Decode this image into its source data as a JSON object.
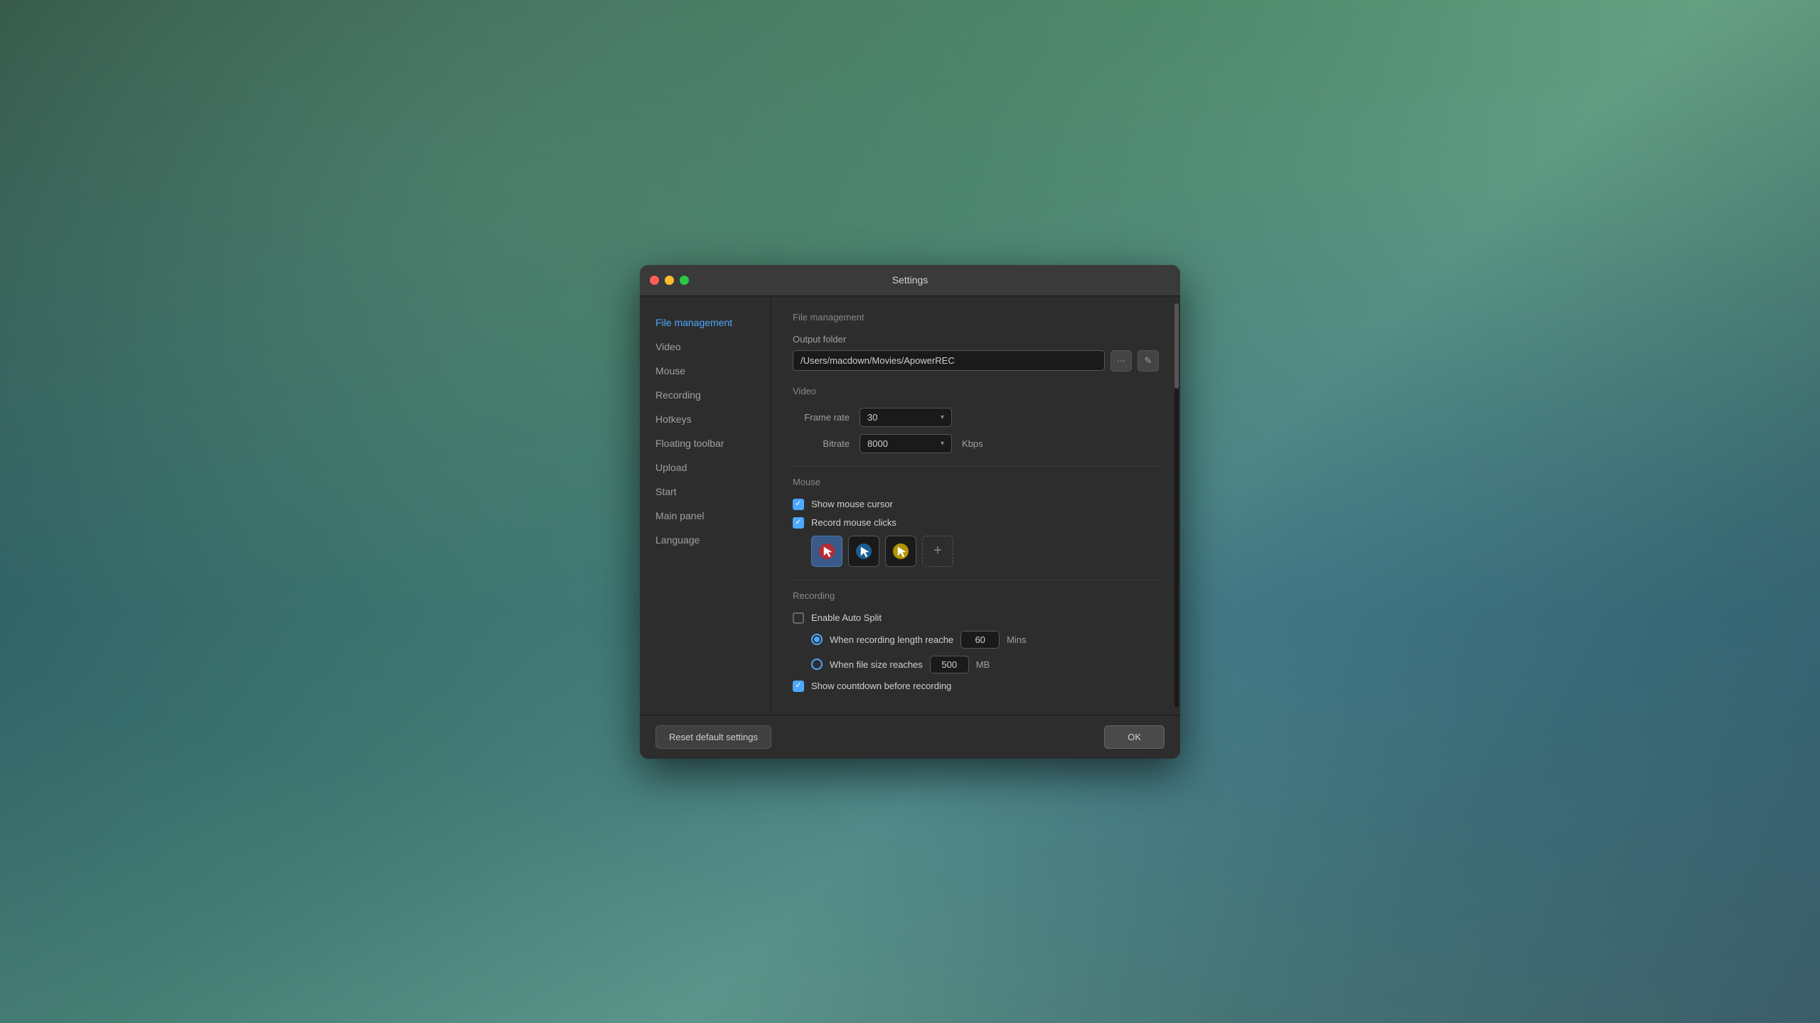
{
  "titleBar": {
    "title": "Settings"
  },
  "sidebar": {
    "items": [
      {
        "id": "file-management",
        "label": "File management",
        "active": true
      },
      {
        "id": "video",
        "label": "Video",
        "active": false
      },
      {
        "id": "mouse",
        "label": "Mouse",
        "active": false
      },
      {
        "id": "recording",
        "label": "Recording",
        "active": false
      },
      {
        "id": "hotkeys",
        "label": "Hotkeys",
        "active": false
      },
      {
        "id": "floating-toolbar",
        "label": "Floating toolbar",
        "active": false
      },
      {
        "id": "upload",
        "label": "Upload",
        "active": false
      },
      {
        "id": "start",
        "label": "Start",
        "active": false
      },
      {
        "id": "main-panel",
        "label": "Main panel",
        "active": false
      },
      {
        "id": "language",
        "label": "Language",
        "active": false
      }
    ]
  },
  "content": {
    "fileManagement": {
      "sectionTitle": "File management",
      "outputFolder": {
        "label": "Output folder",
        "value": "/Users/macdown/Movies/ApowerREC"
      }
    },
    "video": {
      "sectionTitle": "Video",
      "frameRate": {
        "label": "Frame rate",
        "value": "30"
      },
      "bitrate": {
        "label": "Bitrate",
        "value": "8000",
        "unit": "Kbps"
      }
    },
    "mouse": {
      "sectionTitle": "Mouse",
      "showMouseCursor": {
        "label": "Show mouse cursor",
        "checked": true
      },
      "recordMouseClicks": {
        "label": "Record mouse clicks",
        "checked": true
      }
    },
    "recording": {
      "sectionTitle": "Recording",
      "enableAutoSplit": {
        "label": "Enable Auto Split",
        "checked": false
      },
      "whenRecordingLength": {
        "label": "When recording length reache",
        "value": "60",
        "unit": "Mins",
        "checked": true
      },
      "whenFileSize": {
        "label": "When file size reaches",
        "value": "500",
        "unit": "MB",
        "checked": false
      },
      "showCountdown": {
        "label": "Show countdown before recording",
        "checked": true
      }
    }
  },
  "footer": {
    "resetButton": "Reset default settings",
    "okButton": "OK"
  },
  "icons": {
    "folder": "⋯",
    "edit": "✎",
    "check": "✓",
    "plus": "+"
  }
}
